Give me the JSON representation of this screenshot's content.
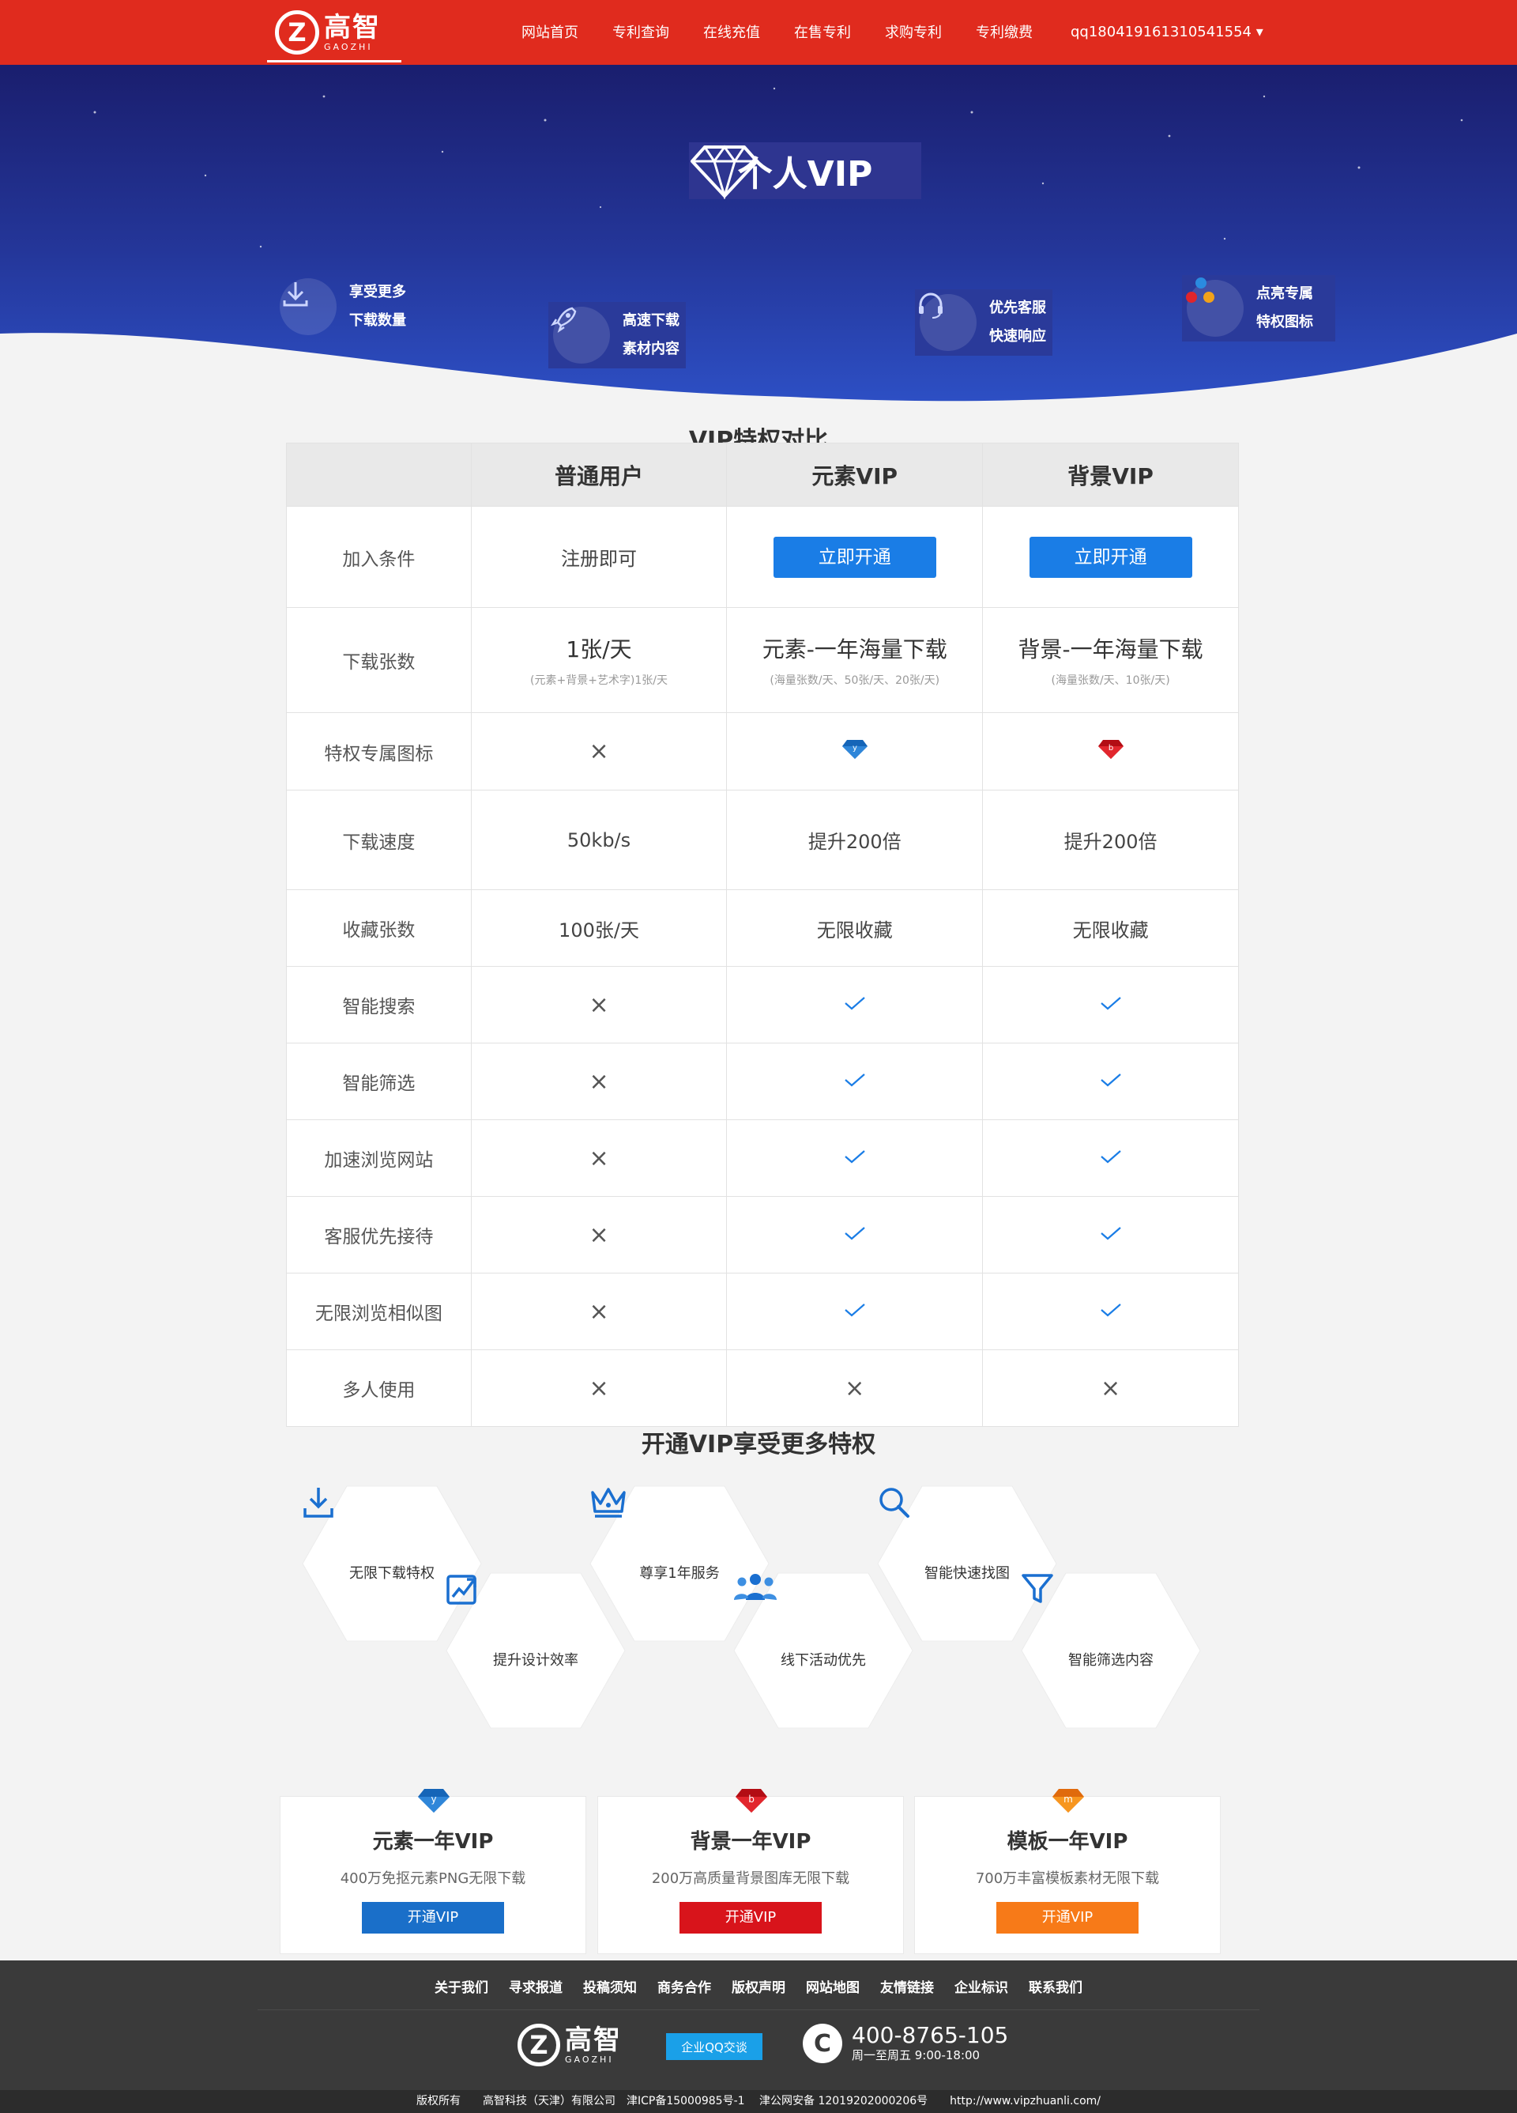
{
  "nav": {
    "logo_cn": "高智",
    "logo_en": "GAOZHI",
    "items": [
      "网站首页",
      "专利查询",
      "在线充值",
      "在售专利",
      "求购专利",
      "专利缴费"
    ],
    "user": "qq180419161310541554 ▾"
  },
  "hero": {
    "title": "个人VIP",
    "features": [
      {
        "line1": "享受更多",
        "line2": "下载数量",
        "icon": "download-icon"
      },
      {
        "line1": "高速下载",
        "line2": "素材内容",
        "icon": "rocket-icon"
      },
      {
        "line1": "优先客服",
        "line2": "快速响应",
        "icon": "headset-icon"
      },
      {
        "line1": "点亮专属",
        "line2": "特权图标",
        "icon": "badge-icon"
      }
    ]
  },
  "compare": {
    "title": "VIP特权对比",
    "headers": [
      "",
      "普通用户",
      "元素VIP",
      "背景VIP"
    ],
    "join": {
      "label": "加入条件",
      "normal": "注册即可",
      "btn": "立即开通"
    },
    "downloads": {
      "label": "下载张数",
      "normal": "1张/天",
      "normal_sub": "(元素+背景+艺术字)1张/天",
      "yuansu": "元素-一年海量下载",
      "yuansu_sub": "(海量张数/天、50张/天、20张/天)",
      "beijing": "背景-一年海量下载",
      "beijing_sub": "(海量张数/天、10张/天)"
    },
    "icon_row": {
      "label": "特权专属图标",
      "normal": "×"
    },
    "speed": {
      "label": "下载速度",
      "normal": "50kb/s",
      "yuansu": "提升200倍",
      "beijing": "提升200倍"
    },
    "collect": {
      "label": "收藏张数",
      "normal": "100张/天",
      "yuansu": "无限收藏",
      "beijing": "无限收藏"
    },
    "bool_rows": [
      {
        "label": "智能搜索",
        "values": [
          false,
          true,
          true
        ]
      },
      {
        "label": "智能筛选",
        "values": [
          false,
          true,
          true
        ]
      },
      {
        "label": "加速浏览网站",
        "values": [
          false,
          true,
          true
        ]
      },
      {
        "label": "客服优先接待",
        "values": [
          false,
          true,
          true
        ]
      },
      {
        "label": "无限浏览相似图",
        "values": [
          false,
          true,
          true
        ]
      },
      {
        "label": "多人使用",
        "values": [
          false,
          false,
          false
        ]
      }
    ],
    "cross_symbol": "×"
  },
  "perks": {
    "title": "开通VIP享受更多特权",
    "items": [
      {
        "label": "无限下载特权",
        "icon": "download-icon"
      },
      {
        "label": "提升设计效率",
        "icon": "chart-up-icon"
      },
      {
        "label": "尊享1年服务",
        "icon": "crown-icon"
      },
      {
        "label": "线下活动优先",
        "icon": "people-icon"
      },
      {
        "label": "智能快速找图",
        "icon": "search-icon"
      },
      {
        "label": "智能筛选内容",
        "icon": "filter-icon"
      }
    ]
  },
  "cards": [
    {
      "title": "元素一年VIP",
      "desc": "400万免抠元素PNG无限下载",
      "btn": "开通VIP",
      "color": "#1a6fc9",
      "badge": "y"
    },
    {
      "title": "背景一年VIP",
      "desc": "200万高质量背景图库无限下载",
      "btn": "开通VIP",
      "color": "#d8141b",
      "badge": "b"
    },
    {
      "title": "模板一年VIP",
      "desc": "700万丰富模板素材无限下载",
      "btn": "开通VIP",
      "color": "#f77a18",
      "badge": "m"
    }
  ],
  "footer": {
    "links": [
      "关于我们",
      "寻求报道",
      "投稿须知",
      "商务合作",
      "版权声明",
      "网站地图",
      "友情链接",
      "企业标识",
      "联系我们"
    ],
    "logo_cn": "高智",
    "logo_en": "GAOZHI",
    "qq": "企业QQ交谈",
    "phone": "400-8765-105",
    "hours": "周一至周五 9:00-18:00",
    "copyright": "版权所有　　高智科技（天津）有限公司　津ICP备15000985号-1　 津公网安备 12019202000206号　　http://www.vipzhuanli.com/"
  }
}
